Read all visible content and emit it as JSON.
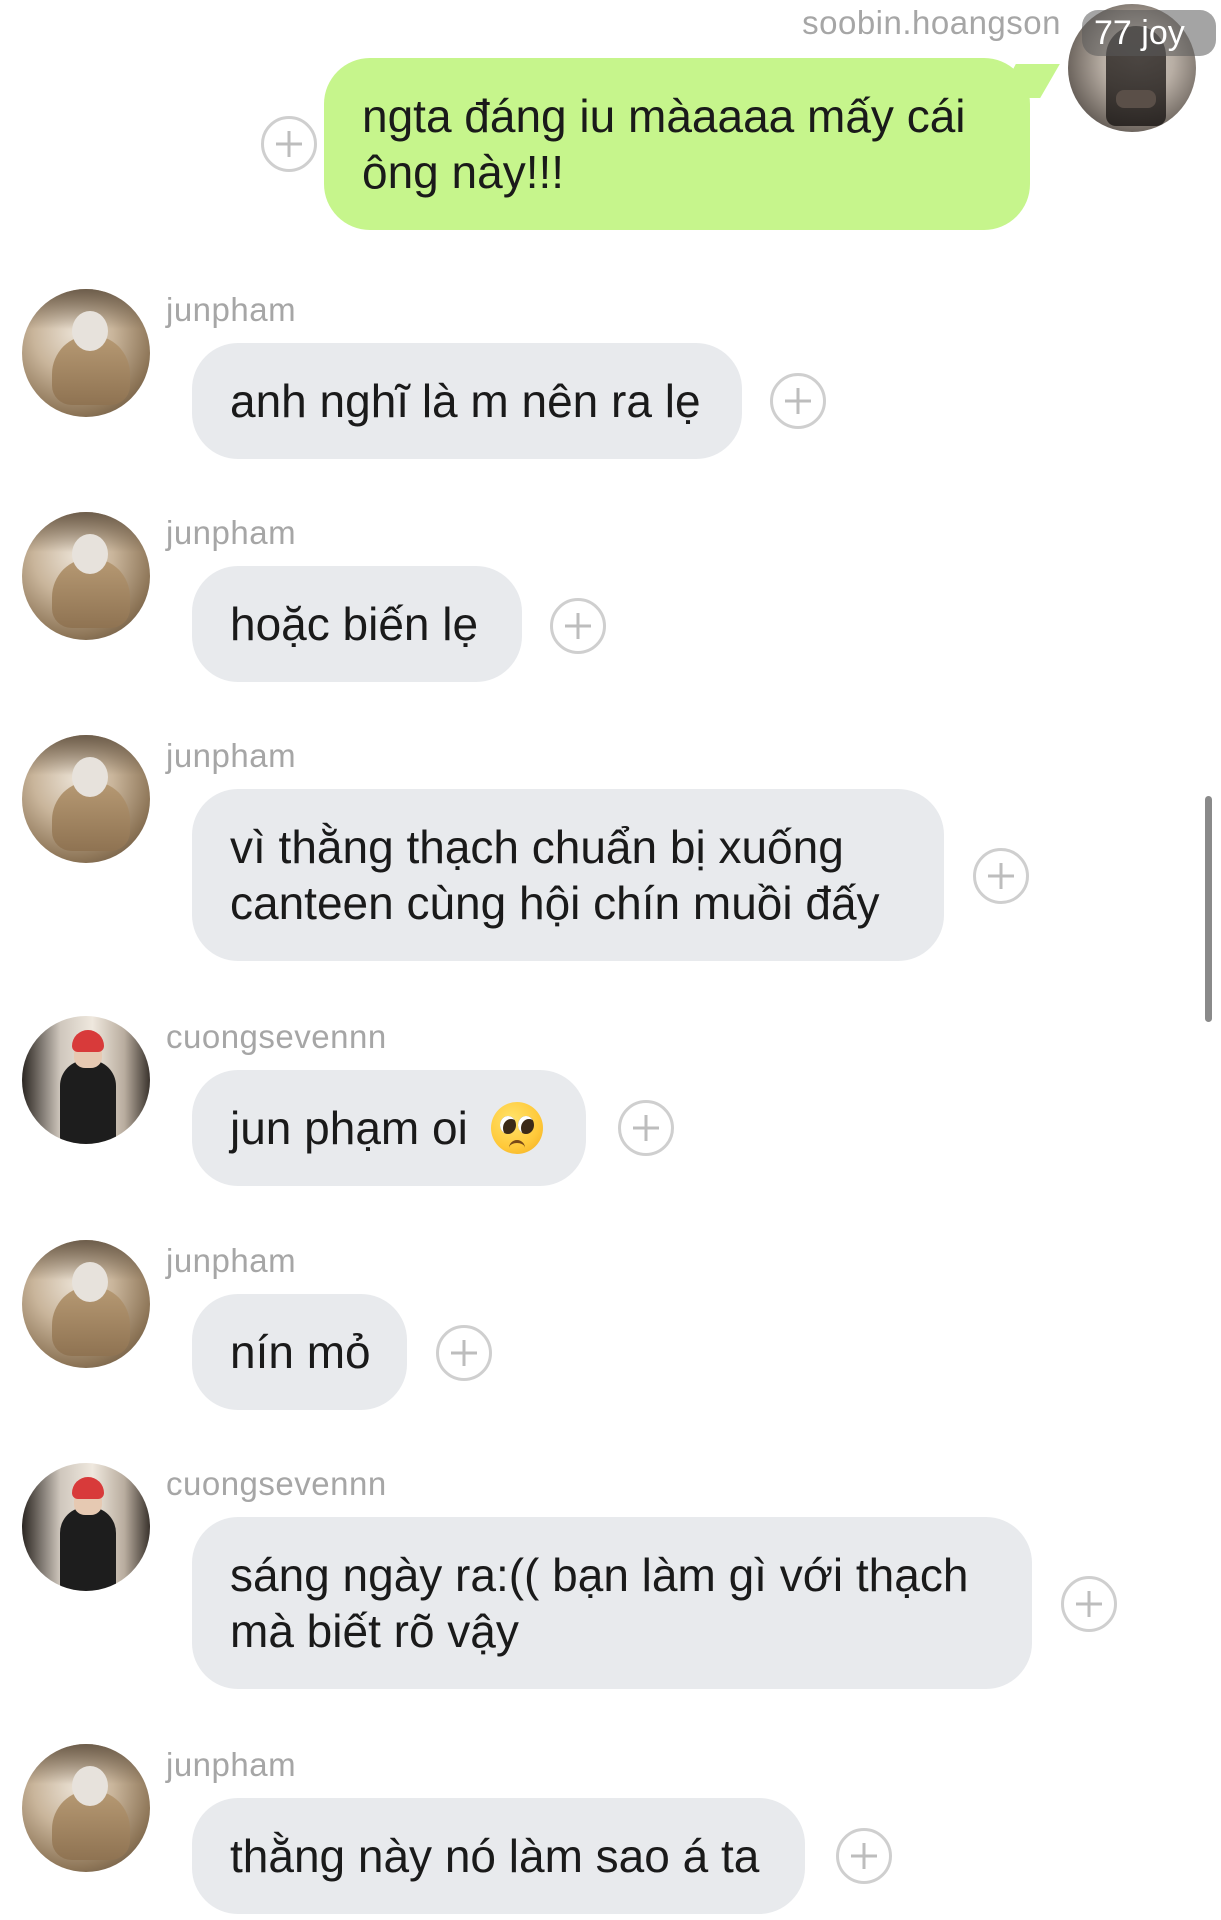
{
  "outgoing": {
    "username": "soobin.hoangson",
    "note": "77 joy",
    "text": "ngta đáng iu màaaaa mấy cái ông này!!!",
    "lines": [
      "ngta đáng iu màaaaa mấy cái",
      "ông này!!!"
    ]
  },
  "messages": [
    {
      "username": "junpham",
      "lines": [
        "anh nghĩ là m nên ra lẹ"
      ]
    },
    {
      "username": "junpham",
      "lines": [
        "hoặc biến lẹ"
      ]
    },
    {
      "username": "junpham",
      "lines": [
        "vì thằng thạch chuẩn bị xuống",
        "canteen cùng hội chín muồi đấy"
      ]
    },
    {
      "username": "cuongsevennn",
      "lines": [
        "jun phạm oi"
      ],
      "emoji": "pleading-face-icon"
    },
    {
      "username": "junpham",
      "lines": [
        "nín mỏ"
      ]
    },
    {
      "username": "cuongsevennn",
      "lines": [
        "sáng ngày ra:(( bạn làm gì với thạch",
        "mà biết rõ vậy"
      ]
    },
    {
      "username": "junpham",
      "lines": [
        "thằng này nó làm sao á ta"
      ]
    }
  ],
  "colors": {
    "outgoing_bubble": "#c6f58c",
    "incoming_bubble": "#e8eaed",
    "username_text": "#a6a6a6"
  }
}
